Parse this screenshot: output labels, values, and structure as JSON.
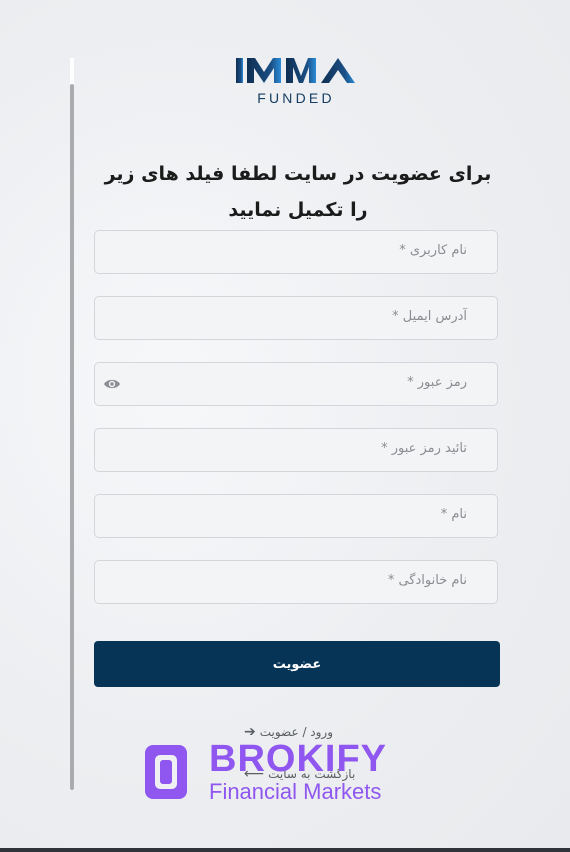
{
  "logo": {
    "mark_text": "IMA",
    "sub_text": "FUNDED"
  },
  "form": {
    "heading": "برای عضویت در سایت لطفا فیلد های زیر را تکمیل نمایید",
    "fields": [
      {
        "placeholder": "نام کاربری *"
      },
      {
        "placeholder": "آدرس ایمیل *"
      },
      {
        "placeholder": "رمز عبور *"
      },
      {
        "placeholder": "تائید رمز عبور *"
      },
      {
        "placeholder": "نام *"
      },
      {
        "placeholder": "نام خانوادگی *"
      }
    ],
    "submit_label": "عضویت"
  },
  "links": {
    "login_register": "ورود / عضویت",
    "back_to_site": "بازگشت به سایت"
  },
  "watermark": {
    "brand": "BROKIFY",
    "tagline": "Financial Markets"
  },
  "colors": {
    "primary": "#053457",
    "watermark": "#8f57f0",
    "logo": "#173e63",
    "logo_accent": "#2a8cd8"
  },
  "icons": {
    "password_toggle": "eye-icon",
    "link_arrow": "arrow-right-icon",
    "back_arrow": "arrow-left-icon"
  }
}
